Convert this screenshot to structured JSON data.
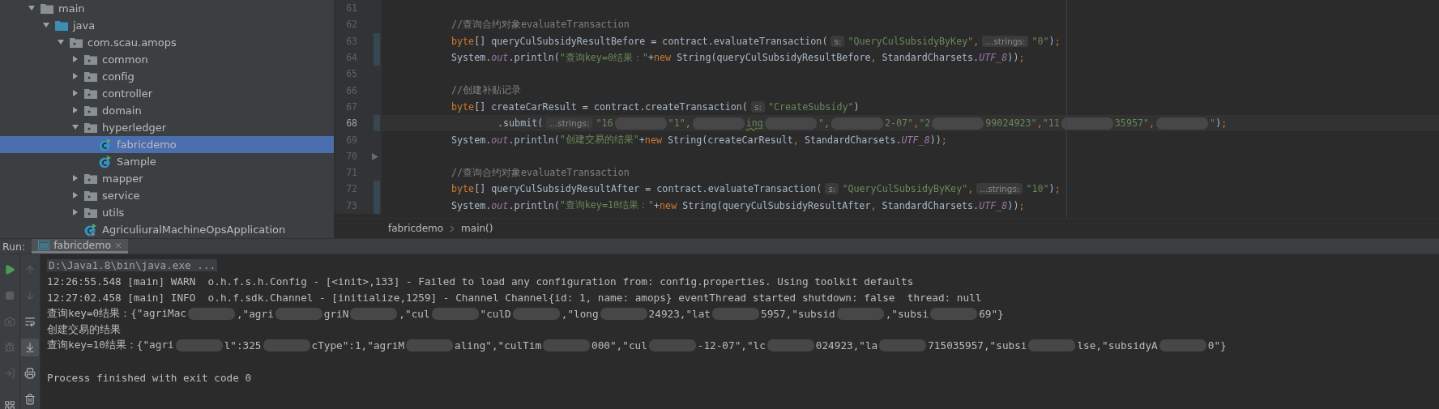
{
  "project_tree": [
    {
      "label": "main",
      "kind": "folder",
      "expanded": true,
      "selected": false,
      "children": [
        {
          "label": "java",
          "kind": "source_root",
          "expanded": true,
          "selected": false,
          "children": [
            {
              "label": "com.scau.amops",
              "kind": "package",
              "expanded": true,
              "selected": false,
              "children": [
                {
                  "label": "common",
                  "kind": "package",
                  "expanded": false,
                  "selected": false
                },
                {
                  "label": "config",
                  "kind": "package",
                  "expanded": false,
                  "selected": false
                },
                {
                  "label": "controller",
                  "kind": "package",
                  "expanded": false,
                  "selected": false
                },
                {
                  "label": "domain",
                  "kind": "package",
                  "expanded": false,
                  "selected": false
                },
                {
                  "label": "hyperledger",
                  "kind": "package",
                  "expanded": true,
                  "selected": false,
                  "children": [
                    {
                      "label": "fabricdemo",
                      "kind": "class",
                      "selected": true
                    },
                    {
                      "label": "Sample",
                      "kind": "class",
                      "selected": false
                    }
                  ]
                },
                {
                  "label": "mapper",
                  "kind": "package",
                  "expanded": false,
                  "selected": false
                },
                {
                  "label": "service",
                  "kind": "package",
                  "expanded": false,
                  "selected": false
                },
                {
                  "label": "utils",
                  "kind": "package",
                  "expanded": false,
                  "selected": false
                },
                {
                  "label": "AgriculiuralMachineOpsApplication",
                  "kind": "app_class",
                  "selected": false
                }
              ]
            }
          ]
        }
      ]
    }
  ],
  "editor": {
    "lines": [
      {
        "number": "61",
        "current": false,
        "changed": false,
        "fold_marker": false
      },
      {
        "number": "62",
        "current": false,
        "changed": false,
        "fold_marker": false,
        "tokens": [
          {
            "kind": "comment",
            "text": "//查询合约对象evaluateTransaction"
          }
        ]
      },
      {
        "number": "63",
        "current": false,
        "changed": true,
        "fold_marker": false,
        "tokens": [
          {
            "kind": "keyword",
            "text": "byte"
          },
          {
            "kind": "plain",
            "text": "[] queryCulSubsidyResultBefore = contract.evaluateTransaction("
          },
          {
            "kind": "hint",
            "text": "s:"
          },
          {
            "kind": "string",
            "text": "\"QueryCulSubsidyByKey\""
          },
          {
            "kind": "punct",
            "text": ","
          },
          {
            "kind": "hint",
            "text": "...strings:"
          },
          {
            "kind": "string",
            "text": "\"0\""
          },
          {
            "kind": "plain",
            "text": ")"
          },
          {
            "kind": "punct",
            "text": ";"
          }
        ]
      },
      {
        "number": "64",
        "current": false,
        "changed": true,
        "fold_marker": false,
        "tokens": [
          {
            "kind": "plain",
            "text": "System."
          },
          {
            "kind": "field",
            "text": "out"
          },
          {
            "kind": "plain",
            "text": ".println("
          },
          {
            "kind": "string",
            "text": "\"查询key=0结果：\""
          },
          {
            "kind": "plain",
            "text": "+"
          },
          {
            "kind": "keyword",
            "text": "new"
          },
          {
            "kind": "plain",
            "text": " String(queryCulSubsidyResultBefore"
          },
          {
            "kind": "punct",
            "text": ","
          },
          {
            "kind": "plain",
            "text": " StandardCharsets."
          },
          {
            "kind": "field",
            "text": "UTF_8"
          },
          {
            "kind": "plain",
            "text": "))"
          },
          {
            "kind": "punct",
            "text": ";"
          }
        ]
      },
      {
        "number": "65",
        "current": false,
        "changed": false,
        "fold_marker": false
      },
      {
        "number": "66",
        "current": false,
        "changed": false,
        "fold_marker": false,
        "tokens": [
          {
            "kind": "comment",
            "text": "//创建补贴记录"
          }
        ]
      },
      {
        "number": "67",
        "current": false,
        "changed": false,
        "fold_marker": false,
        "tokens": [
          {
            "kind": "keyword",
            "text": "byte"
          },
          {
            "kind": "plain",
            "text": "[] createCarResult = contract.createTransaction("
          },
          {
            "kind": "hint",
            "text": "s:"
          },
          {
            "kind": "string",
            "text": "\"CreateSubsidy\""
          },
          {
            "kind": "plain",
            "text": ")"
          }
        ]
      },
      {
        "number": "68",
        "current": true,
        "changed": true,
        "fold_marker": false,
        "tokens": [
          {
            "kind": "chained_call",
            "text": ".submit("
          },
          {
            "kind": "hint",
            "text": "...strings:"
          },
          {
            "kind": "string",
            "text": "\"16"
          },
          {
            "kind": "redacted"
          },
          {
            "kind": "string",
            "text": "\"1\""
          },
          {
            "kind": "punct",
            "text": ","
          },
          {
            "kind": "redacted"
          },
          {
            "kind": "typo",
            "text": "ing"
          },
          {
            "kind": "redacted"
          },
          {
            "kind": "string",
            "text": "\""
          },
          {
            "kind": "punct",
            "text": ","
          },
          {
            "kind": "redacted"
          },
          {
            "kind": "string",
            "text": "2-07\""
          },
          {
            "kind": "punct",
            "text": ","
          },
          {
            "kind": "string",
            "text": "\"2"
          },
          {
            "kind": "redacted"
          },
          {
            "kind": "string",
            "text": "99024923\""
          },
          {
            "kind": "punct",
            "text": ","
          },
          {
            "kind": "string",
            "text": "\"11"
          },
          {
            "kind": "redacted"
          },
          {
            "kind": "string",
            "text": "35957\""
          },
          {
            "kind": "punct",
            "text": ","
          },
          {
            "kind": "redacted"
          },
          {
            "kind": "string",
            "text": "\""
          },
          {
            "kind": "plain",
            "text": ")"
          },
          {
            "kind": "punct",
            "text": ";"
          }
        ]
      },
      {
        "number": "69",
        "current": false,
        "changed": false,
        "fold_marker": false,
        "tokens": [
          {
            "kind": "plain",
            "text": "System."
          },
          {
            "kind": "field",
            "text": "out"
          },
          {
            "kind": "plain",
            "text": ".println("
          },
          {
            "kind": "string",
            "text": "\"创建交易的结果\""
          },
          {
            "kind": "plain",
            "text": "+"
          },
          {
            "kind": "keyword",
            "text": "new"
          },
          {
            "kind": "plain",
            "text": " String(createCarResult"
          },
          {
            "kind": "punct",
            "text": ","
          },
          {
            "kind": "plain",
            "text": " StandardCharsets."
          },
          {
            "kind": "field",
            "text": "UTF_8"
          },
          {
            "kind": "plain",
            "text": "))"
          },
          {
            "kind": "punct",
            "text": ";"
          }
        ]
      },
      {
        "number": "70",
        "current": false,
        "changed": false,
        "fold_marker": true
      },
      {
        "number": "71",
        "current": false,
        "changed": false,
        "fold_marker": false,
        "tokens": [
          {
            "kind": "comment",
            "text": "//查询合约对象evaluateTransaction"
          }
        ]
      },
      {
        "number": "72",
        "current": false,
        "changed": true,
        "fold_marker": false,
        "tokens": [
          {
            "kind": "keyword",
            "text": "byte"
          },
          {
            "kind": "plain",
            "text": "[] queryCulSubsidyResultAfter = contract.evaluateTransaction("
          },
          {
            "kind": "hint",
            "text": "s:"
          },
          {
            "kind": "string",
            "text": "\"QueryCulSubsidyByKey\""
          },
          {
            "kind": "punct",
            "text": ","
          },
          {
            "kind": "hint",
            "text": "...strings:"
          },
          {
            "kind": "string",
            "text": "\"10\""
          },
          {
            "kind": "plain",
            "text": ")"
          },
          {
            "kind": "punct",
            "text": ";"
          }
        ]
      },
      {
        "number": "73",
        "current": false,
        "changed": true,
        "fold_marker": false,
        "tokens": [
          {
            "kind": "plain",
            "text": "System."
          },
          {
            "kind": "field",
            "text": "out"
          },
          {
            "kind": "plain",
            "text": ".println("
          },
          {
            "kind": "string",
            "text": "\"查询key=10结果：\""
          },
          {
            "kind": "plain",
            "text": "+"
          },
          {
            "kind": "keyword",
            "text": "new"
          },
          {
            "kind": "plain",
            "text": " String(queryCulSubsidyResultAfter"
          },
          {
            "kind": "punct",
            "text": ","
          },
          {
            "kind": "plain",
            "text": " StandardCharsets."
          },
          {
            "kind": "field",
            "text": "UTF_8"
          },
          {
            "kind": "plain",
            "text": "))"
          },
          {
            "kind": "punct",
            "text": ";"
          }
        ]
      }
    ],
    "breadcrumbs": [
      "fabricdemo",
      "main()"
    ]
  },
  "run_panel": {
    "label": "Run:",
    "tabs": [
      {
        "label": "fabricdemo",
        "selected": true
      }
    ],
    "console": [
      {
        "kind": "command",
        "segments": [
          {
            "kind": "text",
            "text": "D:\\Java1.8\\bin\\java.exe ..."
          }
        ]
      },
      {
        "kind": "log",
        "segments": [
          {
            "kind": "text",
            "text": "12:26:55.548 [main] WARN  o.h.f.s.h.Config - [<init>,133] - Failed to load any configuration from: config.properties. Using toolkit defaults"
          }
        ]
      },
      {
        "kind": "log",
        "segments": [
          {
            "kind": "text",
            "text": "12:27:02.458 [main] INFO  o.h.f.sdk.Channel - [initialize,1259] - Channel Channel{id: 1, name: amops} eventThread started shutdown: false  thread: null"
          }
        ]
      },
      {
        "kind": "log",
        "segments": [
          {
            "kind": "text",
            "text": "查询key=0结果：{\"agriMac"
          },
          {
            "kind": "redacted"
          },
          {
            "kind": "text",
            "text": ",\"agri"
          },
          {
            "kind": "redacted"
          },
          {
            "kind": "text",
            "text": "griN"
          },
          {
            "kind": "redacted"
          },
          {
            "kind": "text",
            "text": ",\"cul"
          },
          {
            "kind": "redacted"
          },
          {
            "kind": "text",
            "text": "\"culD"
          },
          {
            "kind": "redacted"
          },
          {
            "kind": "text",
            "text": ",\"long"
          },
          {
            "kind": "redacted"
          },
          {
            "kind": "text",
            "text": "24923,\"lat"
          },
          {
            "kind": "redacted"
          },
          {
            "kind": "text",
            "text": "5957,\"subsid"
          },
          {
            "kind": "redacted"
          },
          {
            "kind": "text",
            "text": ",\"subsi"
          },
          {
            "kind": "redacted"
          },
          {
            "kind": "text",
            "text": "69\"}"
          }
        ]
      },
      {
        "kind": "log",
        "segments": [
          {
            "kind": "text",
            "text": "创建交易的结果"
          }
        ]
      },
      {
        "kind": "log",
        "segments": [
          {
            "kind": "text",
            "text": "查询key=10结果：{\"agri"
          },
          {
            "kind": "redacted"
          },
          {
            "kind": "text",
            "text": "l\":325"
          },
          {
            "kind": "redacted"
          },
          {
            "kind": "text",
            "text": "cType\":1,\"agriM"
          },
          {
            "kind": "redacted"
          },
          {
            "kind": "text",
            "text": "aling\",\"culTim"
          },
          {
            "kind": "redacted"
          },
          {
            "kind": "text",
            "text": "000\",\"cul"
          },
          {
            "kind": "redacted"
          },
          {
            "kind": "text",
            "text": "-12-07\",\"lc"
          },
          {
            "kind": "redacted"
          },
          {
            "kind": "text",
            "text": "024923,\"la"
          },
          {
            "kind": "redacted"
          },
          {
            "kind": "text",
            "text": "715035957,\"subsi"
          },
          {
            "kind": "redacted"
          },
          {
            "kind": "text",
            "text": "lse,\"subsidyA"
          },
          {
            "kind": "redacted"
          },
          {
            "kind": "text",
            "text": "0\"}"
          }
        ]
      },
      {
        "kind": "blank"
      },
      {
        "kind": "log",
        "segments": [
          {
            "kind": "text",
            "text": "Process finished with exit code 0"
          }
        ]
      }
    ]
  }
}
